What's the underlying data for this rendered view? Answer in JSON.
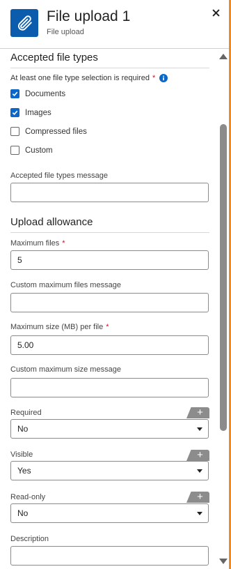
{
  "header": {
    "title": "File upload 1",
    "subtitle": "File upload",
    "close_label": "×"
  },
  "accepted": {
    "section_title": "Accepted file types",
    "required_note": "At least one file type selection is required",
    "required_star": "*",
    "options": [
      {
        "label": "Documents",
        "checked": true
      },
      {
        "label": "Images",
        "checked": true
      },
      {
        "label": "Compressed files",
        "checked": false
      },
      {
        "label": "Custom",
        "checked": false
      }
    ],
    "message_label": "Accepted file types message",
    "message_value": ""
  },
  "allowance": {
    "section_title": "Upload allowance",
    "max_files_label": "Maximum files",
    "max_files_star": "*",
    "max_files_value": "5",
    "custom_max_files_label": "Custom maximum files message",
    "custom_max_files_value": "",
    "max_size_label": "Maximum size (MB) per file",
    "max_size_star": "*",
    "max_size_value": "5.00",
    "custom_max_size_label": "Custom maximum size message",
    "custom_max_size_value": ""
  },
  "properties": {
    "required_label": "Required",
    "required_value": "No",
    "visible_label": "Visible",
    "visible_value": "Yes",
    "readonly_label": "Read-only",
    "readonly_value": "No",
    "description_label": "Description",
    "description_value": "",
    "plus_label": "+"
  },
  "colors": {
    "accent": "#0b5cad",
    "checkbox": "#0b67c8",
    "required": "#c8102e",
    "edge": "#f08a1f"
  }
}
